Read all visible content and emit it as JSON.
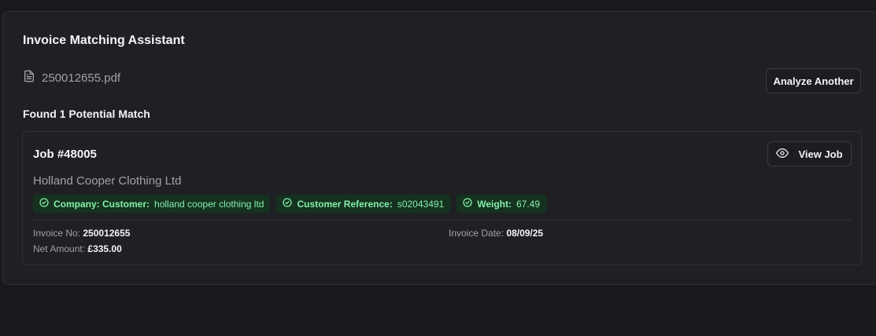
{
  "header": {
    "title": "Invoice Matching Assistant"
  },
  "file": {
    "name": "250012655.pdf",
    "icon": "file-text-icon"
  },
  "actions": {
    "analyze_another": "Analyze Another"
  },
  "results": {
    "found_text": "Found 1 Potential Match"
  },
  "match": {
    "job_title": "Job #48005",
    "view_job_label": "View Job",
    "company": "Holland Cooper Clothing Ltd",
    "badges": [
      {
        "key": "Company: Customer:",
        "value": "holland cooper clothing ltd"
      },
      {
        "key": "Customer Reference:",
        "value": "s02043491"
      },
      {
        "key": "Weight:",
        "value": "67.49"
      }
    ],
    "invoice_no_label": "Invoice No:",
    "invoice_no": "250012655",
    "invoice_date_label": "Invoice Date:",
    "invoice_date": "08/09/25",
    "net_amount_label": "Net Amount:",
    "net_amount": "£335.00"
  },
  "colors": {
    "background": "#18191c",
    "panel": "#1f2024",
    "badge_bg": "#14321f",
    "badge_text": "#86efac"
  }
}
